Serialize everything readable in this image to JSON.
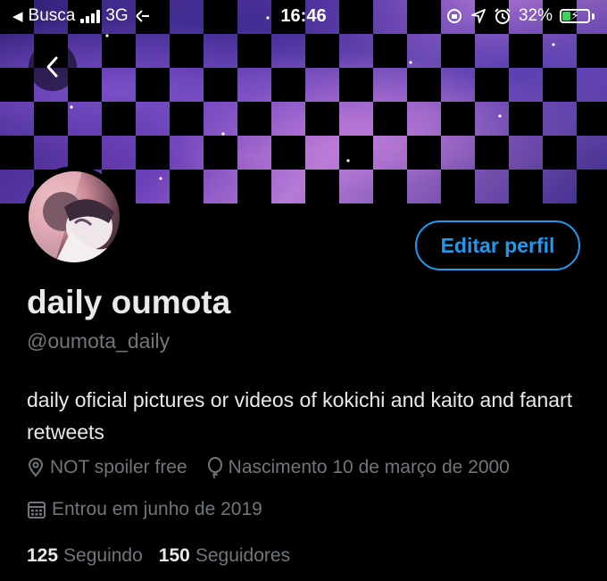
{
  "status_bar": {
    "carrier": "Busca",
    "network": "3G",
    "time": "16:46",
    "battery": "32%",
    "battery_level": 0.32,
    "icons": [
      "back-arrow-icon",
      "signal-bars-icon",
      "hotspot-icon",
      "orientation-lock-icon",
      "location-icon",
      "alarm-icon",
      "battery-icon",
      "charging-bolt-icon"
    ]
  },
  "header": {
    "back_icon": "chevron-left-icon"
  },
  "profile": {
    "display_name": "daily oumota",
    "handle": "@oumota_daily",
    "edit_button_label": "Editar perfil",
    "bio": "daily oficial pictures or videos of kokichi and kaito and fanart retweets",
    "location": "NOT spoiler free",
    "birthday": "Nascimento 10 de março de 2000",
    "joined": "Entrou em junho de 2019",
    "following_count": "125",
    "following_label": "Seguindo",
    "followers_count": "150",
    "followers_label": "Seguidores"
  },
  "colors": {
    "accent": "#1d9bf0",
    "background": "#000000",
    "text_primary": "#e7e9ea",
    "text_secondary": "#71767b",
    "battery_fill": "#3fd25a"
  }
}
